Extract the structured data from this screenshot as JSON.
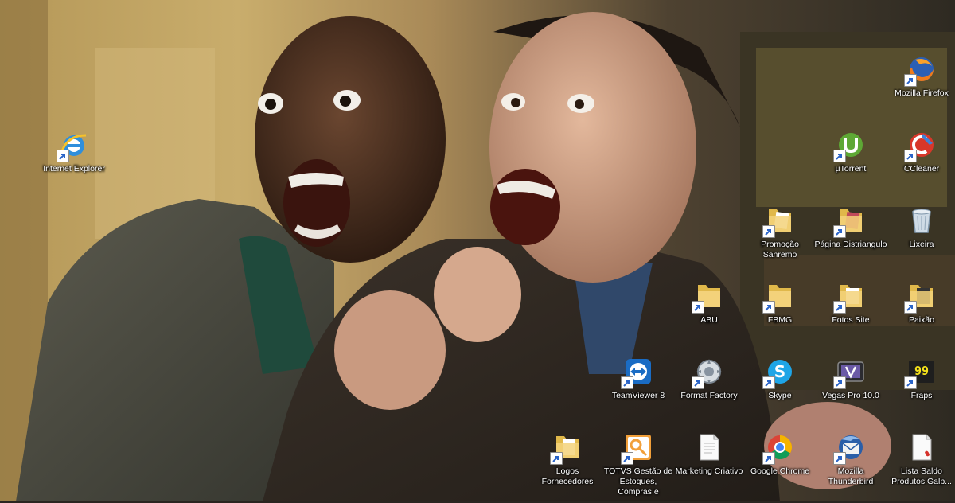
{
  "desktop": {
    "icons": [
      {
        "id": "ie",
        "label": "Internet Explorer",
        "icon": "internet-explorer-icon"
      },
      {
        "id": "firefox",
        "label": "Mozilla Firefox",
        "icon": "firefox-icon"
      },
      {
        "id": "utorrent",
        "label": "µTorrent",
        "icon": "utorrent-icon"
      },
      {
        "id": "ccleaner",
        "label": "CCleaner",
        "icon": "ccleaner-icon"
      },
      {
        "id": "promocao",
        "label": "Promoção Sanremo",
        "icon": "folder-icon"
      },
      {
        "id": "pagina",
        "label": "Página Distriangulo",
        "icon": "folder-icon"
      },
      {
        "id": "lixeira",
        "label": "Lixeira",
        "icon": "recycle-bin-icon"
      },
      {
        "id": "abu",
        "label": "ABU",
        "icon": "folder-icon"
      },
      {
        "id": "fbmg",
        "label": "FBMG",
        "icon": "folder-icon"
      },
      {
        "id": "fotos",
        "label": "Fotos Site",
        "icon": "folder-icon"
      },
      {
        "id": "paixao",
        "label": "Paixão",
        "icon": "folder-icon"
      },
      {
        "id": "teamviewer",
        "label": "TeamViewer 8",
        "icon": "teamviewer-icon"
      },
      {
        "id": "formatfactory",
        "label": "Format Factory",
        "icon": "format-factory-icon"
      },
      {
        "id": "skype",
        "label": "Skype",
        "icon": "skype-icon"
      },
      {
        "id": "vegas",
        "label": "Vegas Pro 10.0",
        "icon": "vegas-pro-icon"
      },
      {
        "id": "fraps",
        "label": "Fraps",
        "icon": "fraps-icon"
      },
      {
        "id": "logos",
        "label": "Logos Fornecedores",
        "icon": "folder-icon"
      },
      {
        "id": "totvs",
        "label": "TOTVS Gestão de Estoques, Compras e",
        "icon": "totvs-icon"
      },
      {
        "id": "marketing",
        "label": "Marketing Criativo",
        "icon": "document-icon"
      },
      {
        "id": "chrome",
        "label": "Google Chrome",
        "icon": "chrome-icon"
      },
      {
        "id": "thunderbird",
        "label": "Mozilla Thunderbird",
        "icon": "thunderbird-icon"
      },
      {
        "id": "lista",
        "label": "Lista Saldo Produtos Galp...",
        "icon": "pdf-document-icon"
      }
    ]
  }
}
